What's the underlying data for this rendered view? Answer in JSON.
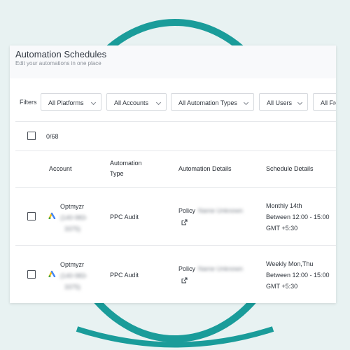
{
  "colors": {
    "ring": "#1a9c9a",
    "background": "#e8f2f2"
  },
  "page": {
    "title": "Automation Schedules",
    "subtitle": "Edit your automations in one place"
  },
  "filters": {
    "label": "Filters",
    "dropdowns": [
      "All Platforms",
      "All Accounts",
      "All Automation Types",
      "All Users",
      "All Fre"
    ]
  },
  "table": {
    "selection": "0/68",
    "headers": {
      "account": "Account",
      "automation_type_line1": "Automation",
      "automation_type_line2": "Type",
      "automation_details": "Automation Details",
      "schedule_details": "Schedule Details"
    },
    "rows": [
      {
        "account_name": "Optmyzr",
        "account_id_line1": "(140-983-",
        "account_id_line2": "3375)",
        "automation_type": "PPC Audit",
        "policy_label": "Policy",
        "policy_name": "Name Unknown",
        "schedule_line1": "Monthly 14th",
        "schedule_line2": "Between 12:00 - 15:00",
        "schedule_line3": "GMT +5:30"
      },
      {
        "account_name": "Optmyzr",
        "account_id_line1": "(140-983-",
        "account_id_line2": "3375)",
        "automation_type": "PPC Audit",
        "policy_label": "Policy",
        "policy_name": "Name Unknown",
        "schedule_line1": "Weekly Mon,Thu",
        "schedule_line2": "Between 12:00 - 15:00",
        "schedule_line3": "GMT +5:30"
      }
    ]
  }
}
